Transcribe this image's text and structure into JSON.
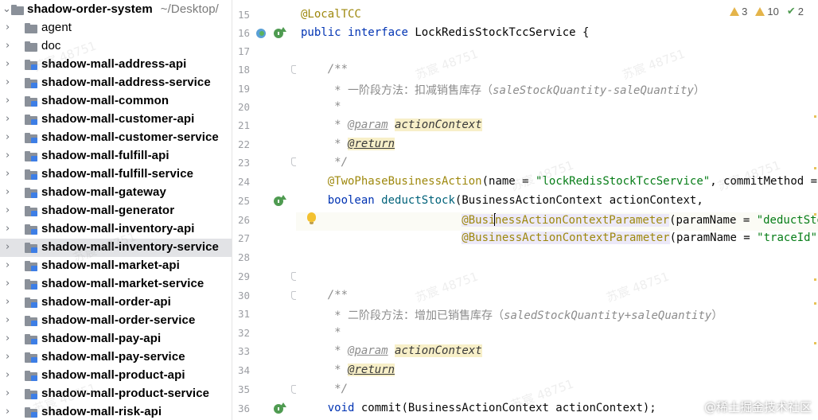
{
  "project_tree": {
    "root": {
      "name": "shadow-order-system",
      "path": "~/Desktop/"
    },
    "items": [
      {
        "label": "agent",
        "kind": "folder"
      },
      {
        "label": "doc",
        "kind": "folder"
      },
      {
        "label": "shadow-mall-address-api",
        "kind": "module"
      },
      {
        "label": "shadow-mall-address-service",
        "kind": "module"
      },
      {
        "label": "shadow-mall-common",
        "kind": "module"
      },
      {
        "label": "shadow-mall-customer-api",
        "kind": "module"
      },
      {
        "label": "shadow-mall-customer-service",
        "kind": "module"
      },
      {
        "label": "shadow-mall-fulfill-api",
        "kind": "module"
      },
      {
        "label": "shadow-mall-fulfill-service",
        "kind": "module"
      },
      {
        "label": "shadow-mall-gateway",
        "kind": "module"
      },
      {
        "label": "shadow-mall-generator",
        "kind": "module"
      },
      {
        "label": "shadow-mall-inventory-api",
        "kind": "module"
      },
      {
        "label": "shadow-mall-inventory-service",
        "kind": "module",
        "selected": true
      },
      {
        "label": "shadow-mall-market-api",
        "kind": "module"
      },
      {
        "label": "shadow-mall-market-service",
        "kind": "module"
      },
      {
        "label": "shadow-mall-order-api",
        "kind": "module"
      },
      {
        "label": "shadow-mall-order-service",
        "kind": "module"
      },
      {
        "label": "shadow-mall-pay-api",
        "kind": "module"
      },
      {
        "label": "shadow-mall-pay-service",
        "kind": "module"
      },
      {
        "label": "shadow-mall-product-api",
        "kind": "module"
      },
      {
        "label": "shadow-mall-product-service",
        "kind": "module"
      },
      {
        "label": "shadow-mall-risk-api",
        "kind": "module"
      }
    ]
  },
  "inspections": {
    "warnings": "3",
    "weak_warnings": "10",
    "ok": "2"
  },
  "editor": {
    "lines": [
      {
        "n": "15",
        "text": "@LocalTCC"
      },
      {
        "n": "16",
        "text": "public interface LockRedisStockTccService {"
      },
      {
        "n": "17",
        "text": ""
      },
      {
        "n": "18",
        "text": "    /**"
      },
      {
        "n": "19",
        "text": "     * 一阶段方法：扣减销售库存（saleStockQuantity-saleQuantity）"
      },
      {
        "n": "20",
        "text": "     *"
      },
      {
        "n": "21",
        "text": "     * @param actionContext"
      },
      {
        "n": "22",
        "text": "     * @return"
      },
      {
        "n": "23",
        "text": "     */"
      },
      {
        "n": "24",
        "text": "    @TwoPhaseBusinessAction(name = \"lockRedisStockTccService\", commitMethod = \""
      },
      {
        "n": "25",
        "text": "    boolean deductStock(BusinessActionContext actionContext,"
      },
      {
        "n": "26",
        "text": "                        @BusinessActionContextParameter(paramName = \"deductStoc"
      },
      {
        "n": "27",
        "text": "                        @BusinessActionContextParameter(paramName = \"traceId\")"
      },
      {
        "n": "28",
        "text": ""
      },
      {
        "n": "29",
        "text": ""
      },
      {
        "n": "30",
        "text": "    /**"
      },
      {
        "n": "31",
        "text": "     * 二阶段方法：增加已销售库存（saledStockQuantity+saleQuantity）"
      },
      {
        "n": "32",
        "text": "     *"
      },
      {
        "n": "33",
        "text": "     * @param actionContext"
      },
      {
        "n": "34",
        "text": "     * @return"
      },
      {
        "n": "35",
        "text": "     */"
      },
      {
        "n": "36",
        "text": "    void commit(BusinessActionContext actionContext);"
      }
    ],
    "tokens": {
      "local_tcc": "@LocalTCC",
      "kw_public": "public",
      "kw_interface": "interface",
      "iface_name": "LockRedisStockTccService",
      "brace_open": " {",
      "doc_open": "/**",
      "doc_star": "*",
      "doc_close": "*/",
      "c19_cn": "一阶段方法：扣减销售库存（",
      "c19_en": "saleStockQuantity-saleQuantity",
      "c19_end": "）",
      "tag_param": "@param",
      "tag_return": "@return",
      "action_context": "actionContext",
      "ann_tpba": "@TwoPhaseBusinessAction",
      "l24_a": "(name = ",
      "l24_str": "\"lockRedisStockTccService\"",
      "l24_b": ", commitMethod = ",
      "l24_str2": "\"",
      "kw_boolean": "boolean",
      "meth_deduct": "deductStock",
      "l25_rest": "(BusinessActionContext actionContext,",
      "ann_bacp_a": "@Busi",
      "ann_bacp_b": "nessActionContextParameter",
      "ann_bacp_full": "@BusinessActionContextParameter",
      "l26_a": "(paramName = ",
      "l26_str": "\"deductStoc",
      "l27_str": "\"traceId\"",
      "l27_end": ")",
      "c31_cn": "二阶段方法：增加已销售库存（",
      "c31_en": "saledStockQuantity+saleQuantity",
      "c31_end": "）",
      "kw_void": "void",
      "l36_rest": " commit(BusinessActionContext actionContext);"
    }
  },
  "watermark": {
    "text": "苏宸 48751"
  },
  "credit": {
    "text": "@稀土掘金技术社区"
  },
  "colors": {
    "selection": "#e2e3e6",
    "keyword": "#0033b3",
    "annotation": "#9e880d",
    "string": "#067d17",
    "comment": "#8c8c8c",
    "method": "#00627a"
  }
}
